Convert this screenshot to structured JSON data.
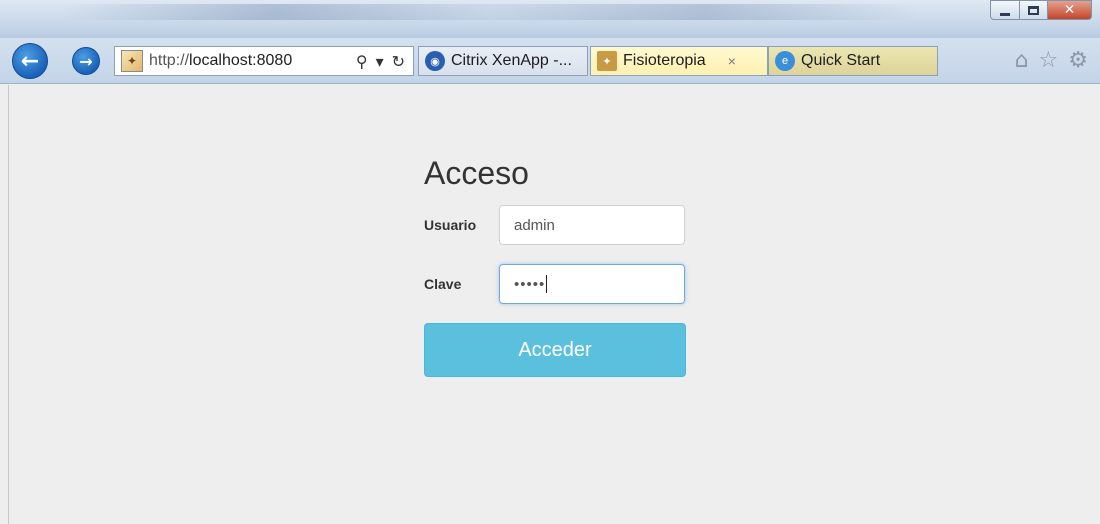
{
  "browser": {
    "address_prefix": "http://",
    "address_host": "localhost:8080",
    "tabs": [
      {
        "label": "Citrix XenApp -...",
        "icon": "citrix-icon",
        "active": false
      },
      {
        "label": "Fisioteropia",
        "icon": "tomcat-icon",
        "active": true
      },
      {
        "label": "Quick Start",
        "icon": "ie-icon",
        "active": false
      }
    ],
    "tab_close": "×"
  },
  "login": {
    "title": "Acceso",
    "user_label": "Usuario",
    "user_value": "admin",
    "password_label": "Clave",
    "password_value": "•••••",
    "submit_label": "Acceder"
  },
  "colors": {
    "submit_bg": "#5bc0de",
    "page_bg": "#eeeeee"
  }
}
